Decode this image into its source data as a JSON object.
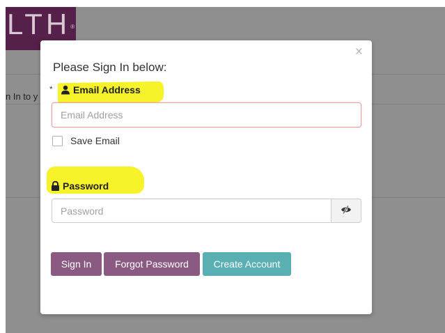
{
  "background": {
    "logo_text": "LTH",
    "logo_mark": "®",
    "partial_text": "n In to y"
  },
  "modal": {
    "title": "Please Sign In below:",
    "close_label": "×",
    "required_marker": "*",
    "email": {
      "icon": "user-icon",
      "label": "Email Address",
      "placeholder": "Email Address",
      "value": ""
    },
    "save_email": {
      "label": "Save Email",
      "checked": false
    },
    "password": {
      "icon": "lock-icon",
      "label": "Password",
      "placeholder": "Password",
      "value": "",
      "toggle_icon": "eye-slash-icon"
    },
    "buttons": {
      "sign_in": "Sign In",
      "forgot_password": "Forgot Password",
      "create_account": "Create Account"
    }
  },
  "colors": {
    "brand_purple": "#8a5a83",
    "teal": "#5aafb3",
    "logo_bg": "#55214a",
    "highlight": "#f6f32a",
    "backdrop": "#8f8f8f"
  }
}
